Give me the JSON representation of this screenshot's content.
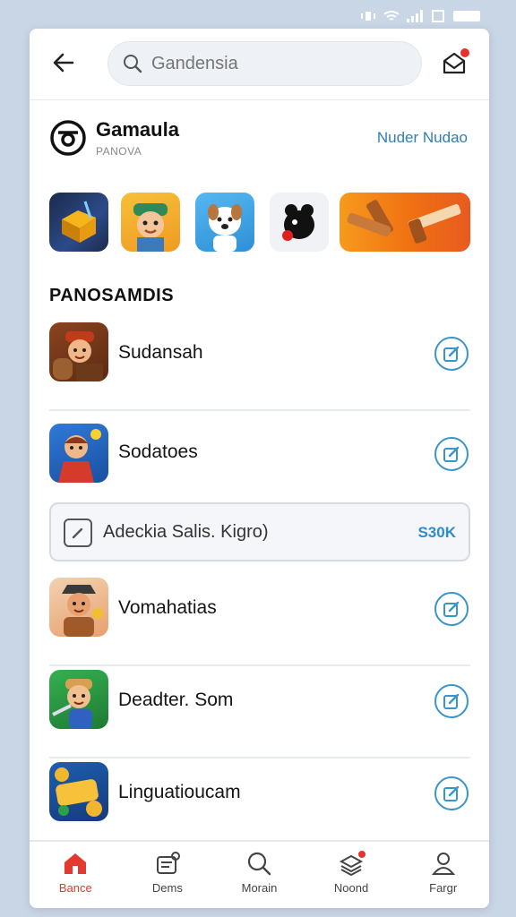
{
  "search": {
    "placeholder": "Gandensia",
    "value": ""
  },
  "brand": {
    "title": "Gamaula",
    "subtitle": "PANOVA",
    "link": "Nuder Nudao"
  },
  "featured": [
    {
      "name": "puzzle-game",
      "colors": [
        "#1c2a4a",
        "#e8a40f"
      ]
    },
    {
      "name": "adventure-game",
      "colors": [
        "#f2a62a",
        "#2e8a5a"
      ]
    },
    {
      "name": "pet-game",
      "colors": [
        "#3aa3e5",
        "#f0c090"
      ]
    },
    {
      "name": "panda-game",
      "colors": [
        "#f0f0f2",
        "#111111"
      ]
    },
    {
      "name": "tools-game",
      "colors": [
        "#f07a18",
        "#f5b85a"
      ]
    }
  ],
  "section_title": "PANOSAMDIS",
  "items": [
    {
      "label": "Sudansah",
      "colors": [
        "#7a3b1a",
        "#d9a35f"
      ]
    },
    {
      "label": "Sodatoes",
      "colors": [
        "#2a68c9",
        "#e8a46a"
      ]
    }
  ],
  "promo": {
    "text": "Adeckia Salis. Kigro)",
    "value": "S30K"
  },
  "items2": [
    {
      "label": "Vomahatias",
      "colors": [
        "#d99a6a",
        "#f5e3cf"
      ]
    },
    {
      "label": "Deadter. Som",
      "colors": [
        "#2fa04a",
        "#e8c090"
      ]
    },
    {
      "label": "Linguatioucam",
      "colors": [
        "#1d5fb0",
        "#f2b530"
      ]
    }
  ],
  "nav": [
    {
      "label": "Bance",
      "icon": "home-icon",
      "active": true
    },
    {
      "label": "Dems",
      "icon": "tag-icon",
      "active": false
    },
    {
      "label": "Morain",
      "icon": "search-icon",
      "active": false
    },
    {
      "label": "Noond",
      "icon": "stack-icon",
      "active": false
    },
    {
      "label": "Fargr",
      "icon": "person-icon",
      "active": false
    }
  ],
  "colors": {
    "accent": "#2f8cc8",
    "nav_active": "#e23a2f",
    "badge": "#e5322d"
  }
}
